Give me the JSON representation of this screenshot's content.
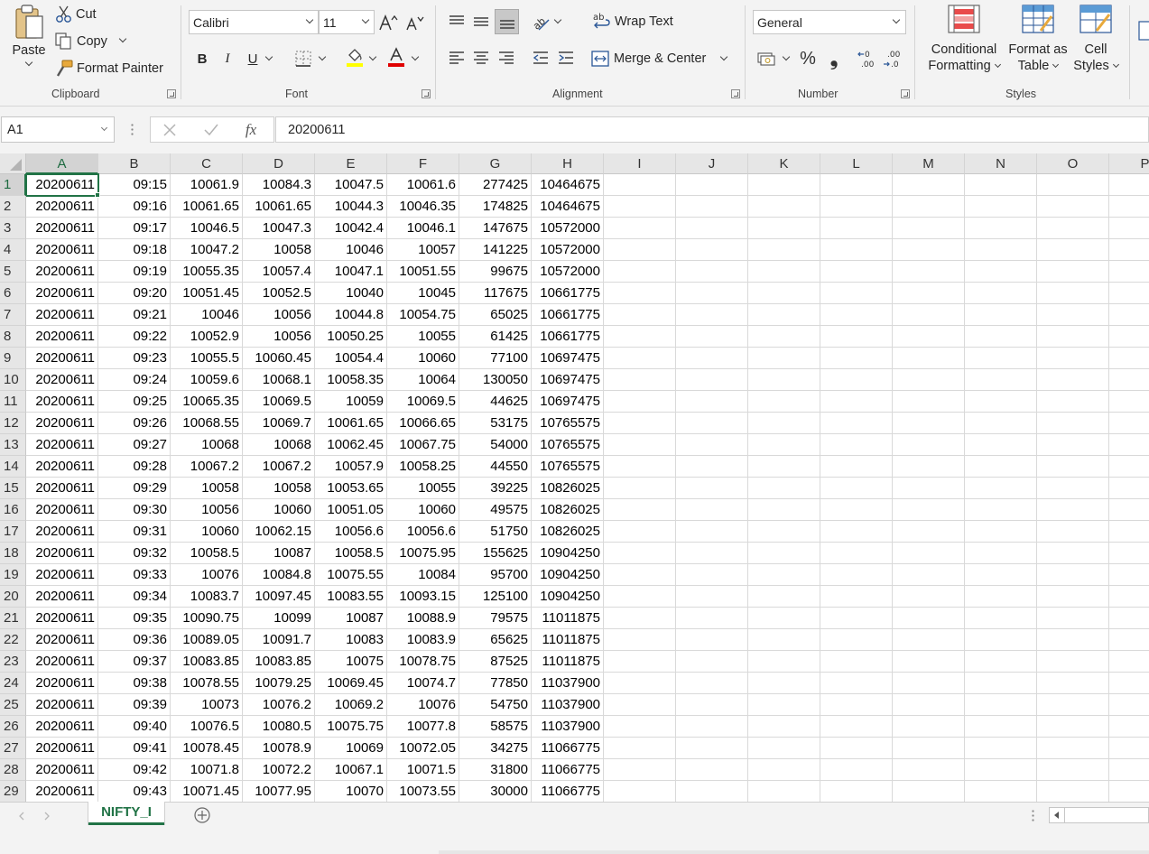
{
  "ribbon": {
    "clipboard": {
      "paste": "Paste",
      "cut": "Cut",
      "copy": "Copy",
      "format_painter": "Format Painter",
      "label": "Clipboard"
    },
    "font": {
      "name": "Calibri",
      "size": "11",
      "bold": "B",
      "italic": "I",
      "underline": "U",
      "label": "Font"
    },
    "alignment": {
      "wrap_text": "Wrap Text",
      "merge_center": "Merge & Center",
      "label": "Alignment"
    },
    "number": {
      "format": "General",
      "percent": "%",
      "comma": "❟",
      "label": "Number"
    },
    "styles": {
      "conditional_1": "Conditional",
      "conditional_2": "Formatting",
      "format_table_1": "Format as",
      "format_table_2": "Table",
      "cell_styles_1": "Cell",
      "cell_styles_2": "Styles",
      "label": "Styles"
    }
  },
  "formula_bar": {
    "name_box": "A1",
    "fx": "fx",
    "value": "20200611"
  },
  "columns": [
    "A",
    "B",
    "C",
    "D",
    "E",
    "F",
    "G",
    "H",
    "I",
    "J",
    "K",
    "L",
    "M",
    "N",
    "O",
    "P"
  ],
  "selected_cell": "A1",
  "rows": [
    [
      "20200611",
      "09:15",
      "10061.9",
      "10084.3",
      "10047.5",
      "10061.6",
      "277425",
      "10464675"
    ],
    [
      "20200611",
      "09:16",
      "10061.65",
      "10061.65",
      "10044.3",
      "10046.35",
      "174825",
      "10464675"
    ],
    [
      "20200611",
      "09:17",
      "10046.5",
      "10047.3",
      "10042.4",
      "10046.1",
      "147675",
      "10572000"
    ],
    [
      "20200611",
      "09:18",
      "10047.2",
      "10058",
      "10046",
      "10057",
      "141225",
      "10572000"
    ],
    [
      "20200611",
      "09:19",
      "10055.35",
      "10057.4",
      "10047.1",
      "10051.55",
      "99675",
      "10572000"
    ],
    [
      "20200611",
      "09:20",
      "10051.45",
      "10052.5",
      "10040",
      "10045",
      "117675",
      "10661775"
    ],
    [
      "20200611",
      "09:21",
      "10046",
      "10056",
      "10044.8",
      "10054.75",
      "65025",
      "10661775"
    ],
    [
      "20200611",
      "09:22",
      "10052.9",
      "10056",
      "10050.25",
      "10055",
      "61425",
      "10661775"
    ],
    [
      "20200611",
      "09:23",
      "10055.5",
      "10060.45",
      "10054.4",
      "10060",
      "77100",
      "10697475"
    ],
    [
      "20200611",
      "09:24",
      "10059.6",
      "10068.1",
      "10058.35",
      "10064",
      "130050",
      "10697475"
    ],
    [
      "20200611",
      "09:25",
      "10065.35",
      "10069.5",
      "10059",
      "10069.5",
      "44625",
      "10697475"
    ],
    [
      "20200611",
      "09:26",
      "10068.55",
      "10069.7",
      "10061.65",
      "10066.65",
      "53175",
      "10765575"
    ],
    [
      "20200611",
      "09:27",
      "10068",
      "10068",
      "10062.45",
      "10067.75",
      "54000",
      "10765575"
    ],
    [
      "20200611",
      "09:28",
      "10067.2",
      "10067.2",
      "10057.9",
      "10058.25",
      "44550",
      "10765575"
    ],
    [
      "20200611",
      "09:29",
      "10058",
      "10058",
      "10053.65",
      "10055",
      "39225",
      "10826025"
    ],
    [
      "20200611",
      "09:30",
      "10056",
      "10060",
      "10051.05",
      "10060",
      "49575",
      "10826025"
    ],
    [
      "20200611",
      "09:31",
      "10060",
      "10062.15",
      "10056.6",
      "10056.6",
      "51750",
      "10826025"
    ],
    [
      "20200611",
      "09:32",
      "10058.5",
      "10087",
      "10058.5",
      "10075.95",
      "155625",
      "10904250"
    ],
    [
      "20200611",
      "09:33",
      "10076",
      "10084.8",
      "10075.55",
      "10084",
      "95700",
      "10904250"
    ],
    [
      "20200611",
      "09:34",
      "10083.7",
      "10097.45",
      "10083.55",
      "10093.15",
      "125100",
      "10904250"
    ],
    [
      "20200611",
      "09:35",
      "10090.75",
      "10099",
      "10087",
      "10088.9",
      "79575",
      "11011875"
    ],
    [
      "20200611",
      "09:36",
      "10089.05",
      "10091.7",
      "10083",
      "10083.9",
      "65625",
      "11011875"
    ],
    [
      "20200611",
      "09:37",
      "10083.85",
      "10083.85",
      "10075",
      "10078.75",
      "87525",
      "11011875"
    ],
    [
      "20200611",
      "09:38",
      "10078.55",
      "10079.25",
      "10069.45",
      "10074.7",
      "77850",
      "11037900"
    ],
    [
      "20200611",
      "09:39",
      "10073",
      "10076.2",
      "10069.2",
      "10076",
      "54750",
      "11037900"
    ],
    [
      "20200611",
      "09:40",
      "10076.5",
      "10080.5",
      "10075.75",
      "10077.8",
      "58575",
      "11037900"
    ],
    [
      "20200611",
      "09:41",
      "10078.45",
      "10078.9",
      "10069",
      "10072.05",
      "34275",
      "11066775"
    ],
    [
      "20200611",
      "09:42",
      "10071.8",
      "10072.2",
      "10067.1",
      "10071.5",
      "31800",
      "11066775"
    ],
    [
      "20200611",
      "09:43",
      "10071.45",
      "10077.95",
      "10070",
      "10073.55",
      "30000",
      "11066775"
    ]
  ],
  "sheet_tabs": [
    {
      "label": "NIFTY_I",
      "active": true
    }
  ],
  "colors": {
    "excel_green": "#217346",
    "font_highlight": "#ffff00",
    "font_color": "#e00000"
  }
}
